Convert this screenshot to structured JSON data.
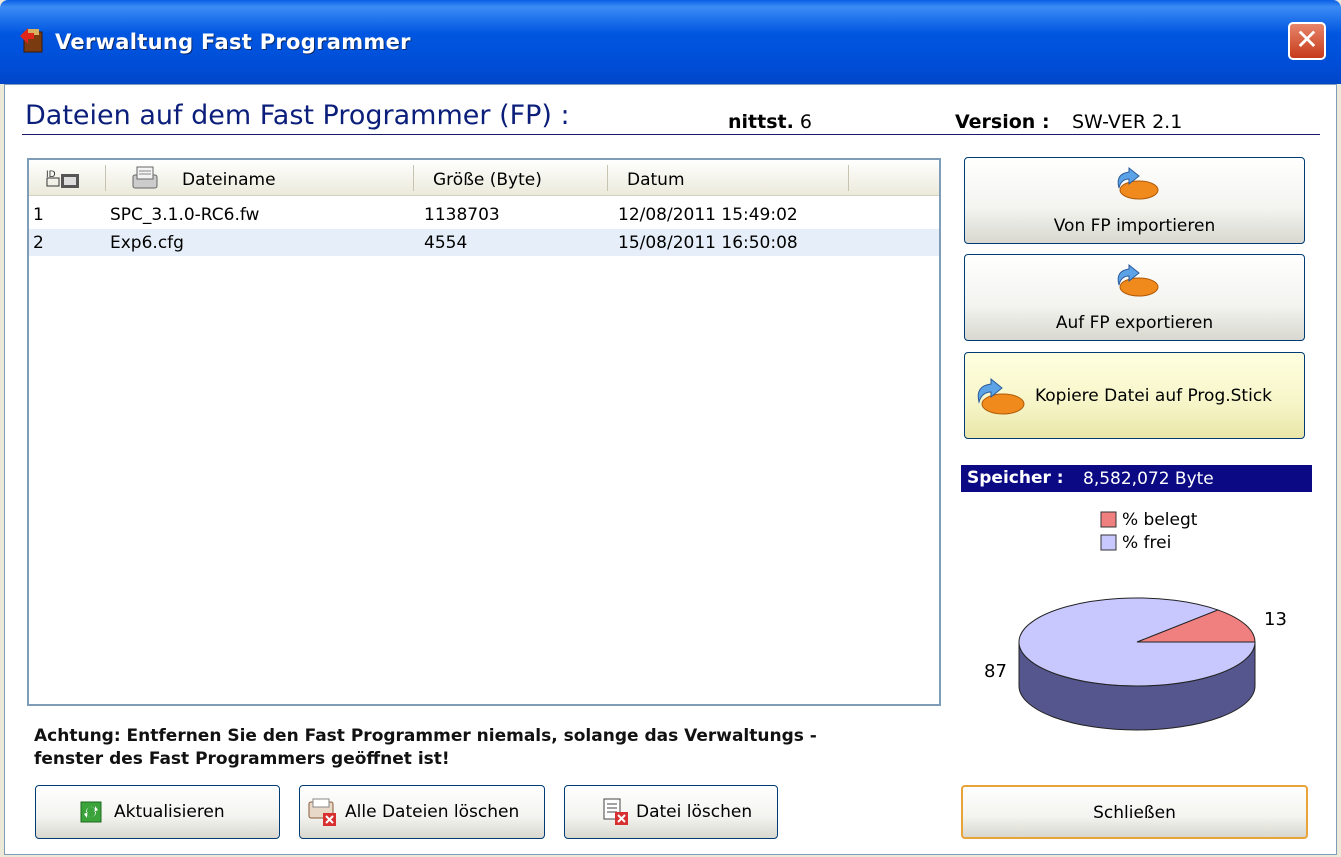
{
  "window": {
    "title": "Verwaltung Fast Programmer",
    "close_symbol": "✕"
  },
  "header": {
    "heading": "Dateien auf dem Fast Programmer (FP) :",
    "port_label": "nittst.",
    "port_value": "6",
    "version_label": "Version :",
    "version_value": "SW-VER 2.1"
  },
  "table": {
    "columns": [
      "",
      "Dateiname",
      "Größe (Byte)",
      "Datum"
    ],
    "rows": [
      {
        "id": "1",
        "name": "SPC_3.1.0-RC6.fw",
        "size": "1138703",
        "date": "12/08/2011 15:49:02"
      },
      {
        "id": "2",
        "name": "Exp6.cfg",
        "size": "4554",
        "date": "15/08/2011 16:50:08"
      }
    ]
  },
  "actions": {
    "import_label": "Von FP importieren",
    "export_label": "Auf FP exportieren",
    "copy_stick_label": "Kopiere Datei auf Prog.Stick"
  },
  "memory": {
    "label": "Speicher :",
    "value": "8,582,072 Byte"
  },
  "chart_data": {
    "type": "pie",
    "categories": [
      "% belegt",
      "% frei"
    ],
    "values": [
      13,
      87
    ],
    "colors": [
      "#F08080",
      "#C8C8FF"
    ],
    "data_labels": [
      "13",
      "87"
    ],
    "legend_position": "top",
    "title": ""
  },
  "warning": {
    "line1": "Achtung: Entfernen Sie den Fast Programmer niemals, solange das Verwaltungs -",
    "line2": "fenster des Fast Programmers geöffnet ist!"
  },
  "bottom": {
    "refresh_label": "Aktualisieren",
    "delete_all_label": "Alle Dateien löschen",
    "delete_label": "Datei löschen",
    "close_label": "Schließen"
  }
}
